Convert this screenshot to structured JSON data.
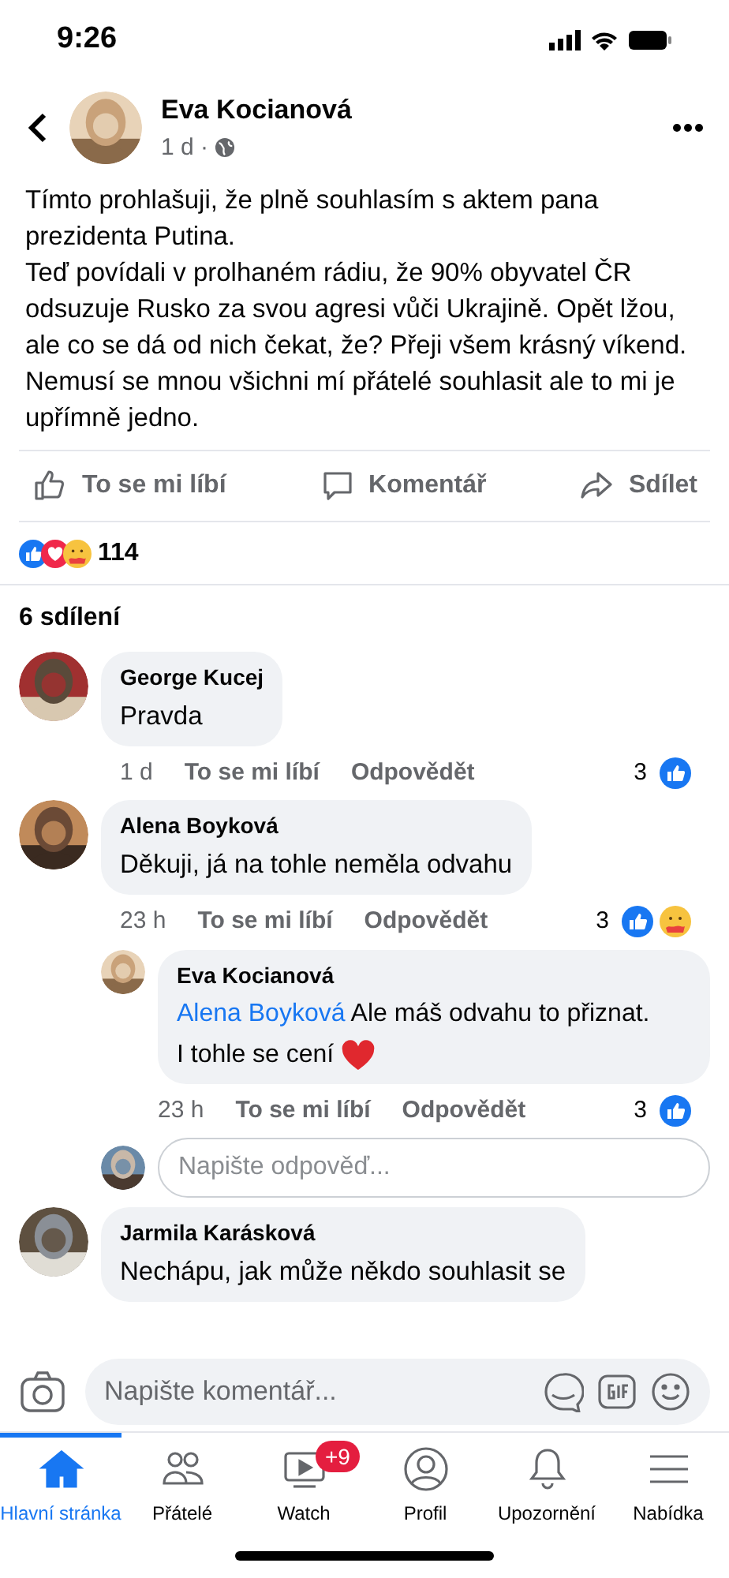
{
  "status_bar": {
    "time": "9:26"
  },
  "post": {
    "author": "Eva Kocianová",
    "time": "1 d ·",
    "paragraphs": [
      "Tímto prohlašuji, že plně souhlasím s aktem pana prezidenta Putina.",
      "Teď povídali v prolhaném rádiu, že 90% obyvatel ČR odsuzuje Rusko za svou agresi vůči Ukrajině. Opět lžou, ale co se dá od nich čekat, že? Přeji všem krásný víkend. Nemusí se mnou všichni mí přátelé souhlasit ale to mi je upřímně jedno."
    ]
  },
  "actions": [
    {
      "kind": "like",
      "label": "To se mi líbí"
    },
    {
      "kind": "comment",
      "label": "Komentář"
    },
    {
      "kind": "share",
      "label": "Sdílet"
    }
  ],
  "reactions": {
    "kinds": [
      {
        "kind": "like"
      },
      {
        "kind": "love"
      },
      {
        "kind": "care"
      }
    ],
    "count": "114"
  },
  "shares": "6 sdílení",
  "comments": [
    {
      "author": "George Kucej",
      "text": "Pravda",
      "time": "1 d",
      "like_label": "To se mi líbí",
      "reply_label": "Odpovědět",
      "count": "3",
      "reactions": [
        {
          "kind": "like"
        }
      ]
    },
    {
      "author": "Alena Boyková",
      "text": "Děkuji, já na tohle neměla odvahu",
      "time": "23 h",
      "like_label": "To se mi líbí",
      "reply_label": "Odpovědět",
      "count": "3",
      "reactions": [
        {
          "kind": "like"
        },
        {
          "kind": "care"
        }
      ],
      "replies": [
        {
          "author": "Eva Kocianová",
          "mention": "Alena Boyková",
          "text": "Ale máš odvahu to přiznat.",
          "text_2": "I tohle se cení",
          "time": "23 h",
          "like_label": "To se mi líbí",
          "reply_label": "Odpovědět",
          "count": "3",
          "reactions": [
            {
              "kind": "like"
            }
          ]
        }
      ],
      "reply_placeholder": "Napište odpověď..."
    },
    {
      "author": "Jarmila Karásková",
      "text": "Nechápu, jak může někdo souhlasit se"
    }
  ],
  "composer": {
    "placeholder": "Napište komentář..."
  },
  "nav": [
    {
      "kind": "home",
      "label": "Hlavní stránka",
      "selected": true
    },
    {
      "kind": "friends",
      "label": "Přátelé",
      "selected": false
    },
    {
      "kind": "watch",
      "label": "Watch",
      "selected": false,
      "badge": "+9"
    },
    {
      "kind": "profile",
      "label": "Profil",
      "selected": false
    },
    {
      "kind": "bell",
      "label": "Upozornění",
      "selected": false
    },
    {
      "kind": "menu",
      "label": "Nabídka",
      "selected": false
    }
  ]
}
